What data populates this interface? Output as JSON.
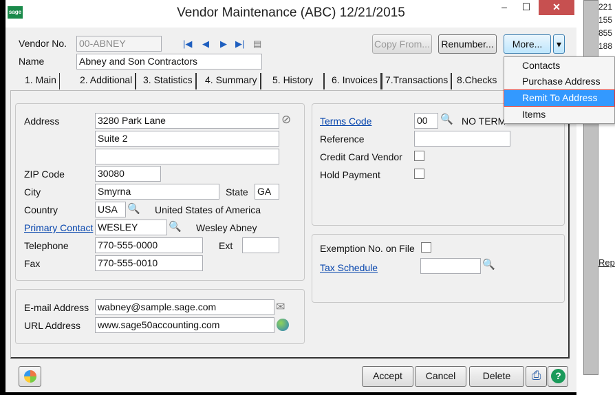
{
  "window": {
    "title": "Vendor Maintenance (ABC) 12/21/2015",
    "logo": "sage",
    "minimize": "–",
    "maximize": "☐",
    "close": "✕"
  },
  "header": {
    "vendor_no_label": "Vendor No.",
    "vendor_no": "00-ABNEY",
    "name_label": "Name",
    "name": "Abney and Son Contractors",
    "buttons": {
      "copy_from": "Copy From...",
      "renumber": "Renumber...",
      "more": "More...",
      "more_arrow": "▾"
    }
  },
  "tabs": [
    "1. Main",
    "2. Additional",
    "3. Statistics",
    "4. Summary",
    "5. History",
    "6. Invoices",
    "7.Transactions",
    "8.Checks"
  ],
  "more_menu": {
    "items": [
      "Contacts",
      "Purchase Address",
      "Remit To Address",
      "Items"
    ],
    "selected": "Remit To Address"
  },
  "address": {
    "address_label": "Address",
    "line1": "3280 Park Lane",
    "line2": "Suite 2",
    "line3": "",
    "zip_label": "ZIP Code",
    "zip": "30080",
    "city_label": "City",
    "city": "Smyrna",
    "state_label": "State",
    "state": "GA",
    "country_label": "Country",
    "country": "USA",
    "country_name": "United States of America",
    "contact_label": "Primary Contact",
    "contact": "WESLEY",
    "contact_name": "Wesley Abney",
    "telephone_label": "Telephone",
    "telephone": "770-555-0000",
    "ext_label": "Ext",
    "ext": "",
    "fax_label": "Fax",
    "fax": "770-555-0010"
  },
  "web": {
    "email_label": "E-mail Address",
    "email": "wabney@sample.sage.com",
    "url_label": "URL Address",
    "url": "www.sage50accounting.com"
  },
  "terms": {
    "terms_label": "Terms Code",
    "terms": "00",
    "terms_desc": "NO TERM",
    "reference_label": "Reference",
    "reference": "",
    "credit_card_label": "Credit Card Vendor",
    "credit_card": false,
    "hold_label": "Hold Payment",
    "hold": false
  },
  "tax": {
    "exemption_label": "Exemption No. on File",
    "exemption": false,
    "schedule_label": "Tax Schedule",
    "schedule": ""
  },
  "footer": {
    "accept": "Accept",
    "cancel": "Cancel",
    "delete": "Delete"
  },
  "background_app": {
    "numbers": [
      "221",
      "155",
      "855",
      "188"
    ],
    "link": "Rep"
  },
  "colors": {
    "accent": "#3399ff",
    "close": "#c75050",
    "link": "#0645ad",
    "logo": "#1a8a4a"
  }
}
